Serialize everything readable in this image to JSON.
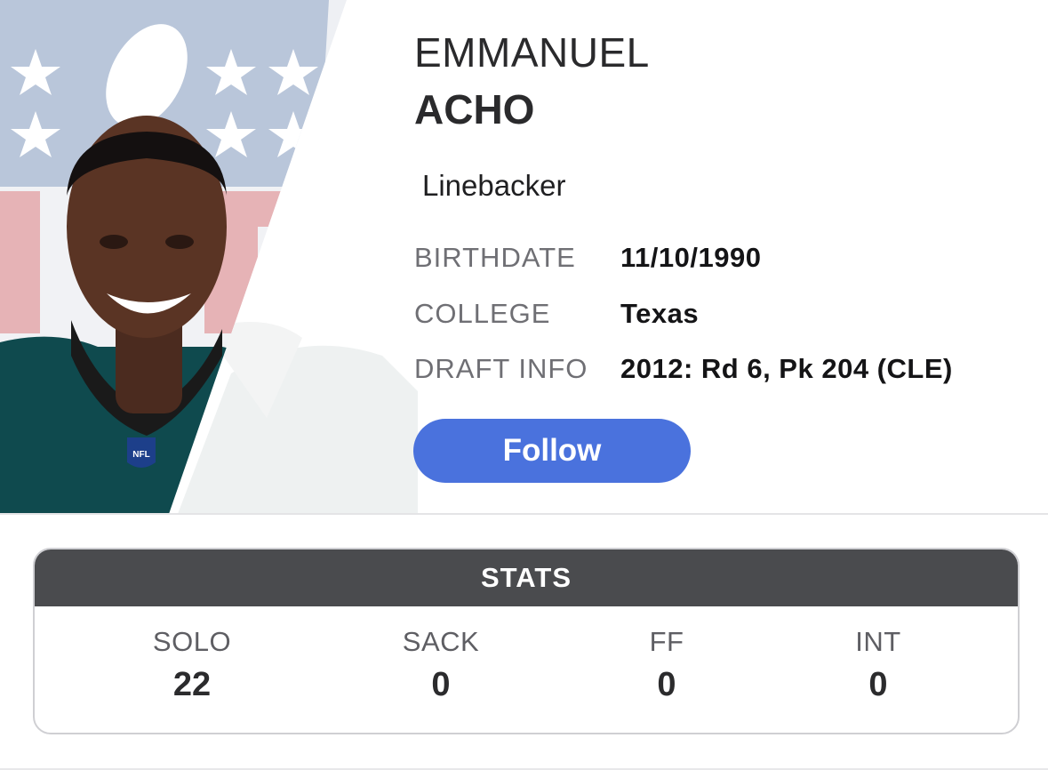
{
  "player": {
    "first_name": "EMMANUEL",
    "last_name": "ACHO",
    "position": "Linebacker",
    "photo_icon": "player-headshot",
    "info": [
      {
        "label": "BIRTHDATE",
        "value": "11/10/1990"
      },
      {
        "label": "COLLEGE",
        "value": "Texas"
      },
      {
        "label": "DRAFT INFO",
        "value": "2012: Rd 6, Pk 204 (CLE)"
      }
    ]
  },
  "follow": {
    "label": "Follow",
    "color": "#4a72dd"
  },
  "stats": {
    "header": "STATS",
    "header_color": "#4a4b4e",
    "items": [
      {
        "label": "SOLO",
        "value": "22"
      },
      {
        "label": "SACK",
        "value": "0"
      },
      {
        "label": "FF",
        "value": "0"
      },
      {
        "label": "INT",
        "value": "0"
      }
    ]
  },
  "colors": {
    "jersey": "#0f4a4e",
    "shield_blue": "#b9c6da",
    "shield_red": "#e6b3b6"
  }
}
